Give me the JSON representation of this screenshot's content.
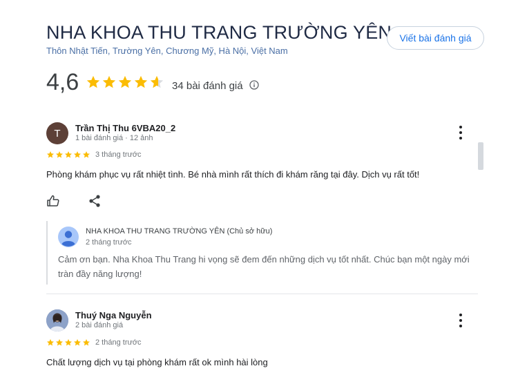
{
  "header": {
    "title": "NHA KHOA THU TRANG TRƯỜNG YÊN",
    "address": "Thôn Nhật Tiến, Trường Yên, Chương Mỹ, Hà Nội, Việt Nam",
    "write_review_label": "Viết bài đánh giá",
    "rating": "4,6",
    "rating_value": 4.6,
    "review_count": "34 bài đánh giá"
  },
  "reviews": [
    {
      "avatar_letter": "T",
      "avatar_color": "#5d4037",
      "name": "Trần Thị Thu 6VBA20_2",
      "meta": "1 bài đánh giá · 12 ảnh",
      "stars": 5,
      "time": "3 tháng trước",
      "text": "Phòng khám phục vụ rất nhiệt tình. Bé nhà mình rất thích đi khám răng tại đây. Dịch vụ rất tốt!",
      "reply": {
        "owner": "NHA KHOA THU TRANG TRƯỜNG YÊN (Chủ sở hữu)",
        "time": "2 tháng trước",
        "text": "Cảm ơn bạn. Nha Khoa Thu Trang hi vọng sẽ đem đến những dịch vụ tốt nhất. Chúc bạn một ngày mới tràn đầy năng lượng!"
      }
    },
    {
      "name": "Thuý Nga Nguyễn",
      "meta": "2 bài đánh giá",
      "stars": 5,
      "time": "2 tháng trước",
      "text": "Chất lượng dịch vụ tại phòng khám rất ok mình hài lòng"
    }
  ],
  "colors": {
    "star": "#fbbc04",
    "accent": "#1a73e8"
  }
}
